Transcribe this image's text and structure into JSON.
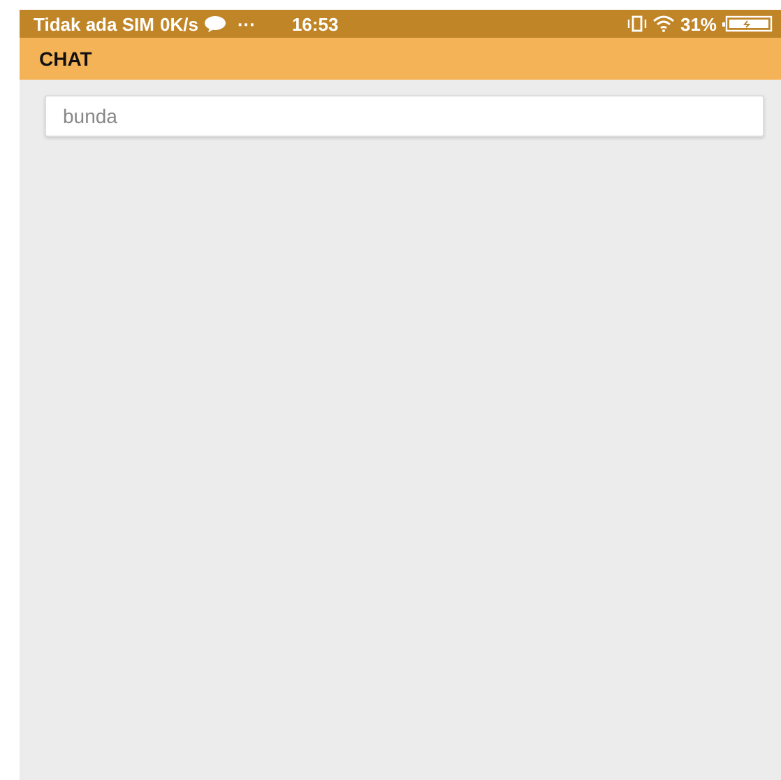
{
  "status_bar": {
    "carrier": "Tidak ada SIM",
    "speed": "0K/s",
    "dots": "···",
    "time": "16:53",
    "battery": "31%"
  },
  "app_bar": {
    "title": "CHAT"
  },
  "search": {
    "placeholder": "bunda"
  }
}
